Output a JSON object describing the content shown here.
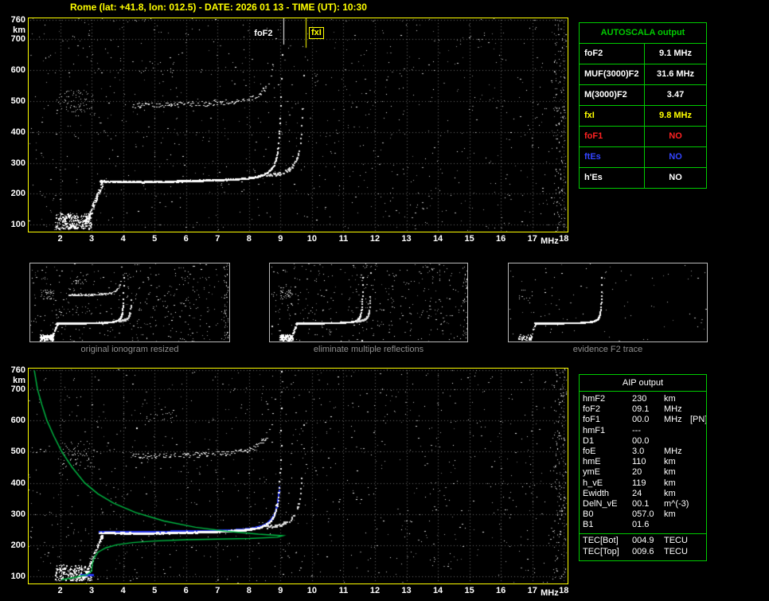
{
  "header": {
    "title": "Rome (lat: +41.8, lon: 012.5) - DATE: 2026 01 13 - TIME (UT): 10:30"
  },
  "chart_data": {
    "type": "scatter",
    "title": "Vertical-incidence ionogram: virtual height vs sounding frequency",
    "xlabel": "MHz",
    "ylabel": "km",
    "xlim": [
      1,
      18.12
    ],
    "ylim": [
      78,
      766
    ],
    "x_ticks": [
      2,
      3,
      4,
      5,
      6,
      7,
      8,
      9,
      10,
      11,
      12,
      13,
      14,
      15,
      16,
      17,
      18
    ],
    "y_ticks": [
      760,
      700,
      600,
      500,
      400,
      300,
      200,
      100
    ],
    "grid": true,
    "markers": {
      "foF2_label": "foF2",
      "foF2_mhz": 9.1,
      "fxI_label": "fxI",
      "fxI_mhz": 9.8
    },
    "f2_trace": {
      "base_km": 240,
      "start_mhz": 3.25,
      "critical_mhz": 9.1
    },
    "x_trace": {
      "base_km": 250,
      "start_mhz": 8.55,
      "critical_mhz": 9.8
    },
    "second_hop": {
      "base_km": 481,
      "start_mhz": 4.3,
      "critical_mhz": 9.0
    },
    "profile_points_f_km": [
      [
        1.18,
        760
      ],
      [
        1.28,
        700
      ],
      [
        1.42,
        650
      ],
      [
        1.58,
        600
      ],
      [
        1.8,
        550
      ],
      [
        2.05,
        500
      ],
      [
        2.38,
        450
      ],
      [
        2.78,
        400
      ],
      [
        3.2,
        365
      ],
      [
        3.7,
        335
      ],
      [
        4.4,
        305
      ],
      [
        5.3,
        278
      ],
      [
        6.3,
        258
      ],
      [
        7.3,
        245
      ],
      [
        8.3,
        236
      ],
      [
        9.08,
        231
      ],
      [
        8.9,
        226
      ],
      [
        8.0,
        222
      ],
      [
        7.0,
        220
      ],
      [
        6.0,
        218
      ],
      [
        5.0,
        214
      ],
      [
        4.3,
        209
      ],
      [
        3.8,
        202
      ],
      [
        3.45,
        192
      ],
      [
        3.2,
        178
      ],
      [
        3.08,
        160
      ],
      [
        3.02,
        140
      ],
      [
        3.0,
        118
      ],
      [
        2.85,
        106
      ],
      [
        2.45,
        97
      ],
      [
        2.05,
        90
      ]
    ],
    "reconstructed_trace": {
      "base_km": 241,
      "start_mhz": 3.25,
      "critical_mhz": 9.1,
      "max_km": 392
    },
    "e_segment": {
      "km": 106,
      "from_mhz": 2.65,
      "to_mhz": 3.05
    }
  },
  "autoscala_table": {
    "title": "AUTOSCALA output",
    "rows": [
      {
        "label": "foF2",
        "value": "9.1 MHz",
        "color": "#ffffff"
      },
      {
        "label": "MUF(3000)F2",
        "value": "31.6 MHz",
        "color": "#ffffff"
      },
      {
        "label": "M(3000)F2",
        "value": "3.47",
        "color": "#ffffff"
      },
      {
        "label": "fxI",
        "value": "9.8 MHz",
        "color": "#ffff00"
      },
      {
        "label": "foF1",
        "value": "NO",
        "color": "#ff2222"
      },
      {
        "label": "ftEs",
        "value": "NO",
        "color": "#3344ff"
      },
      {
        "label": "h'Es",
        "value": "NO",
        "color": "#ffffff"
      }
    ]
  },
  "thumbnails": [
    {
      "caption": "original ionogram resized"
    },
    {
      "caption": "eliminate multiple reflections"
    },
    {
      "caption": "evidence F2 trace"
    }
  ],
  "aip_table": {
    "title": "AIP output",
    "rows": [
      {
        "label": "hmF2",
        "value": "230",
        "unit": "km",
        "extra": ""
      },
      {
        "label": "foF2",
        "value": "09.1",
        "unit": "MHz",
        "extra": ""
      },
      {
        "label": "foF1",
        "value": "00.0",
        "unit": "MHz",
        "extra": "[PN]"
      },
      {
        "label": "hmF1",
        "value": "---",
        "unit": "",
        "extra": ""
      },
      {
        "label": "D1",
        "value": "00.0",
        "unit": "",
        "extra": ""
      },
      {
        "label": "foE",
        "value": "3.0",
        "unit": "MHz",
        "extra": ""
      },
      {
        "label": "hmE",
        "value": "110",
        "unit": "km",
        "extra": ""
      },
      {
        "label": "ymE",
        "value": "20",
        "unit": "km",
        "extra": ""
      },
      {
        "label": "h_vE",
        "value": "119",
        "unit": "km",
        "extra": ""
      },
      {
        "label": "Ewidth",
        "value": "24",
        "unit": "km",
        "extra": ""
      },
      {
        "label": "DelN_vE",
        "value": "00.1",
        "unit": "m^(-3)",
        "extra": ""
      },
      {
        "label": "B0",
        "value": "057.0",
        "unit": "km",
        "extra": ""
      },
      {
        "label": "B1",
        "value": "01.6",
        "unit": "",
        "extra": ""
      }
    ],
    "tec_rows": [
      {
        "label": "TEC[Bot]",
        "value": "004.9",
        "unit": "TECU"
      },
      {
        "label": "TEC[Top]",
        "value": "009.6",
        "unit": "TECU"
      }
    ]
  },
  "colors": {
    "plot_border": "#ffff00",
    "table_green": "#00cc00",
    "profile_green": "#00bb44",
    "trace_blue": "#2233ee",
    "caption_gray": "#8f8f8f",
    "title_yellow": "#ffff00"
  }
}
